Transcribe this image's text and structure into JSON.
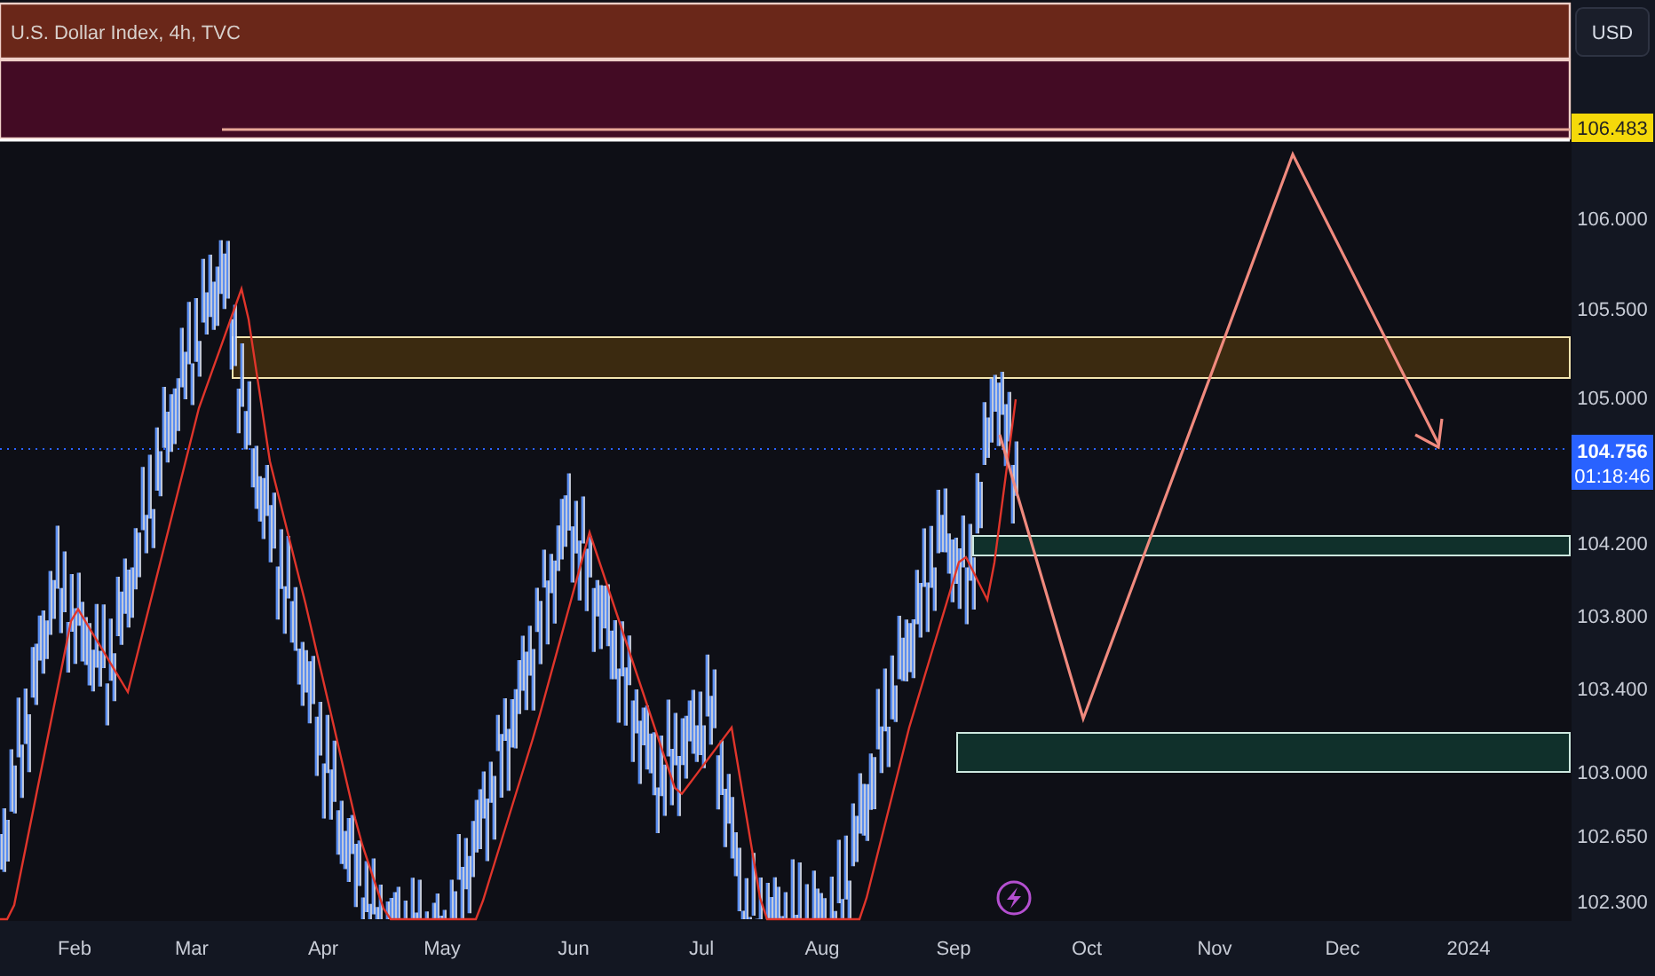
{
  "chart_header": {
    "title": "U.S. Dollar Index, 4h, TVC"
  },
  "currency_button": {
    "label": "USD"
  },
  "price_axis": {
    "ticks": [
      "106.000",
      "105.500",
      "105.000",
      "104.200",
      "103.800",
      "103.400",
      "103.000",
      "102.650",
      "102.300"
    ]
  },
  "price_labels": [
    {
      "kind": "alert",
      "text": "106.483"
    },
    {
      "kind": "last",
      "text": "104.756",
      "countdown": "01:18:46"
    }
  ],
  "time_axis": {
    "labels": [
      "Feb",
      "Mar",
      "Apr",
      "May",
      "Jun",
      "Jul",
      "Aug",
      "Sep",
      "Oct",
      "Nov",
      "Dec",
      "2024"
    ]
  }
}
